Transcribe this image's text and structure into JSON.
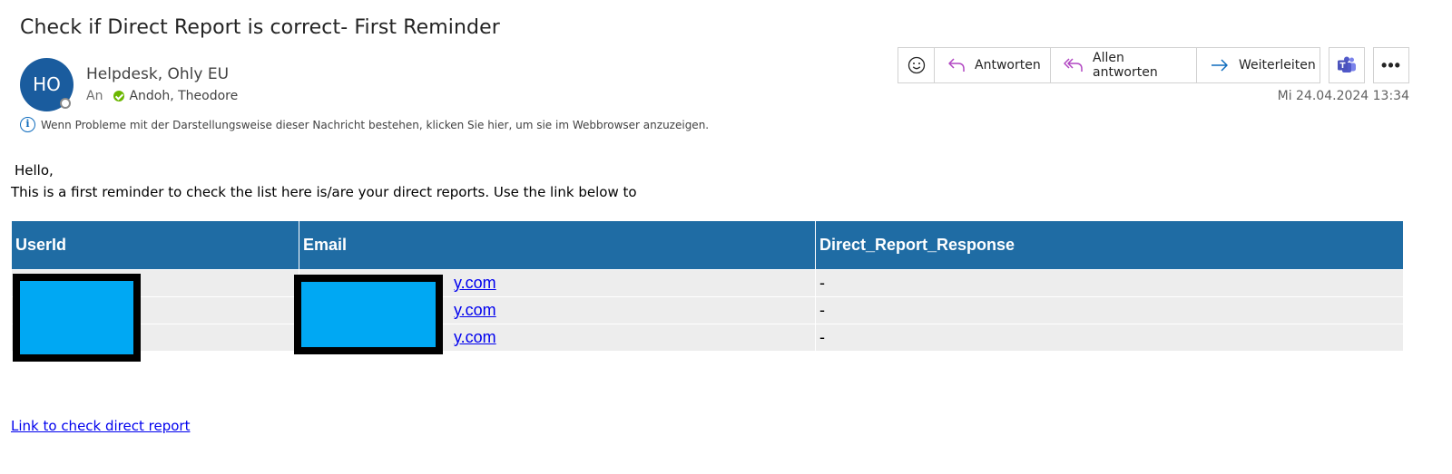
{
  "email": {
    "subject": "Check if Direct Report is correct- First Reminder",
    "sender": {
      "initials": "HO",
      "name": "Helpdesk, Ohly EU"
    },
    "to_label": "An",
    "recipient": "Andoh, Theodore",
    "info_bar": "Wenn Probleme mit der Darstellungsweise dieser Nachricht bestehen, klicken Sie hier, um sie im Webbrowser anzuzeigen.",
    "datetime": "Mi 24.04.2024 13:34"
  },
  "toolbar": {
    "reply_label": "Antworten",
    "reply_all_label": "Allen antworten",
    "forward_label": "Weiterleiten",
    "more_label": "•••"
  },
  "body": {
    "greeting": "Hello,",
    "line1": "This is a first reminder to check the list here is/are your direct reports. Use the link below to",
    "link_text": "Link to check direct report"
  },
  "table": {
    "headers": [
      "UserId",
      "Email",
      "Direct_Report_Response"
    ],
    "rows": [
      {
        "userid": "",
        "email": "y.com",
        "response": "-"
      },
      {
        "userid": "",
        "email": "y.com",
        "response": "-"
      },
      {
        "userid": "",
        "email": "y.com",
        "response": "-"
      }
    ]
  },
  "colors": {
    "table_header": "#1f6ca4",
    "avatar": "#1a5c9e",
    "redaction_fill": "#00a8f3",
    "presence_green": "#6bb700",
    "link": "#0000ee"
  },
  "icons": [
    "emoji-icon",
    "reply-icon",
    "reply-all-icon",
    "forward-icon",
    "teams-icon",
    "more-icon",
    "info-icon",
    "check-icon"
  ]
}
